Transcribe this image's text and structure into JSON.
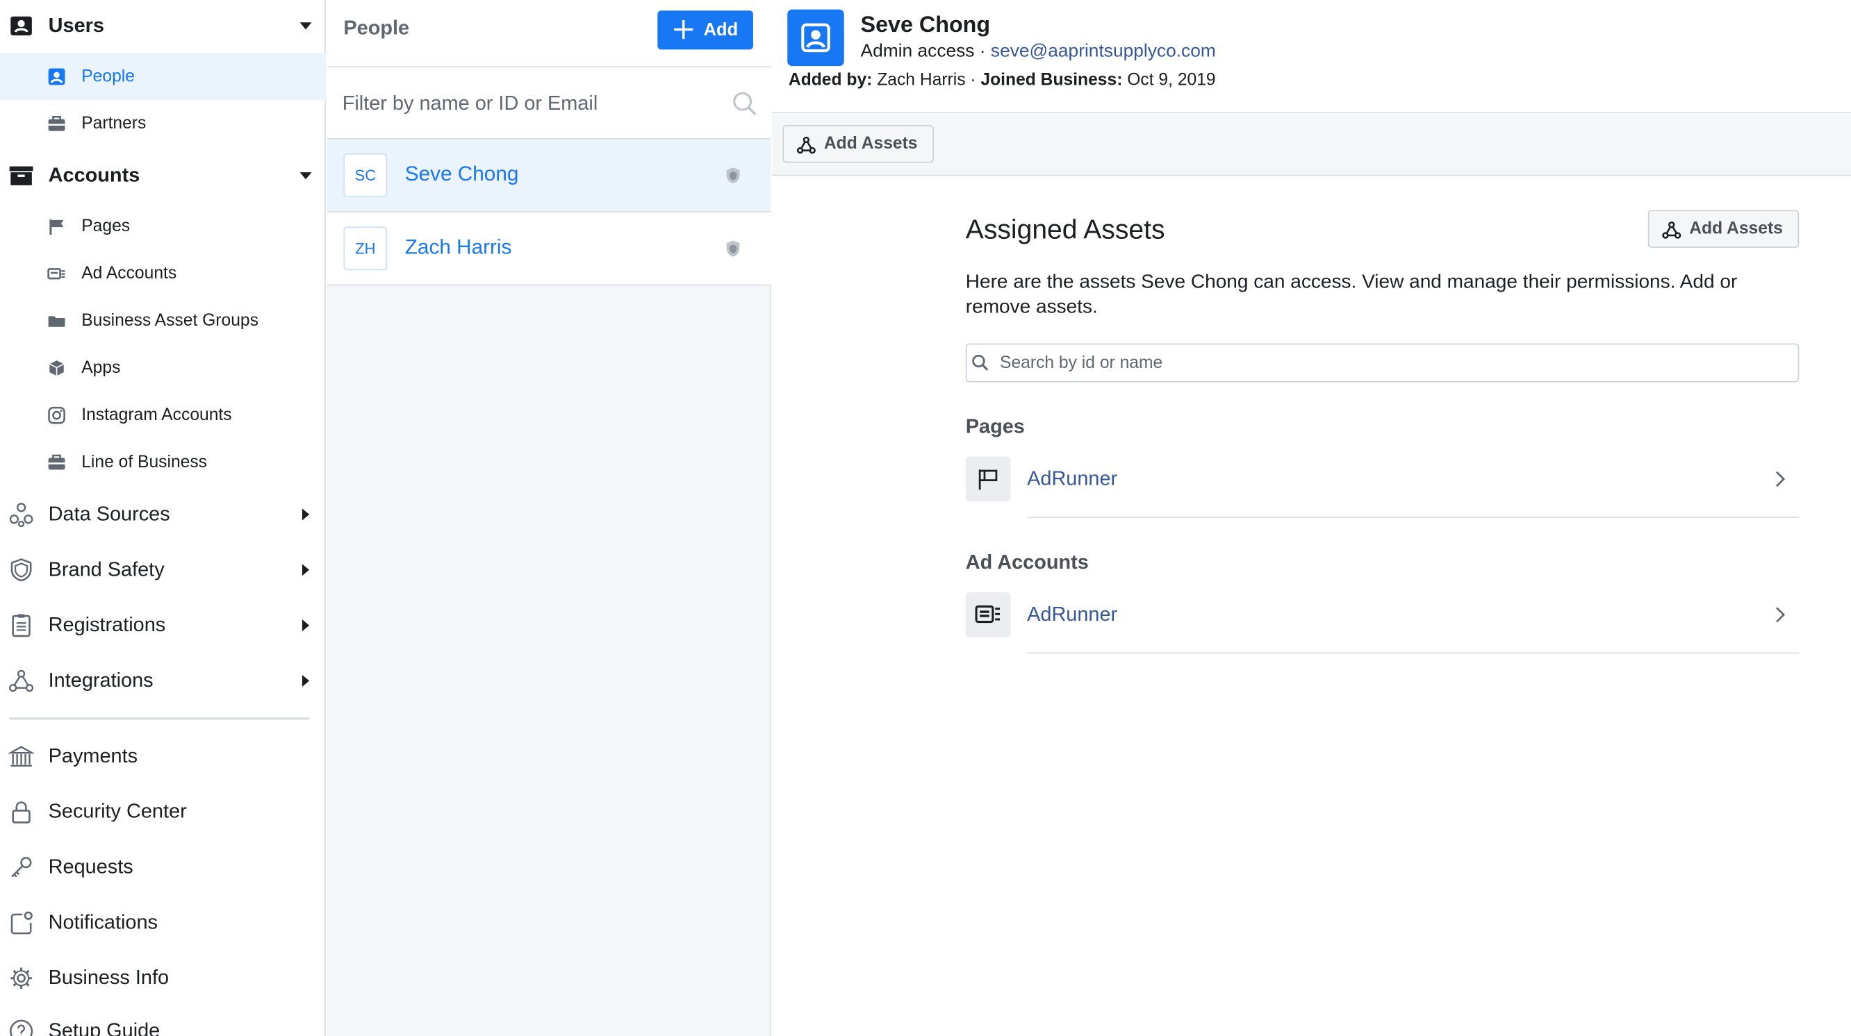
{
  "sidebar": {
    "users": {
      "label": "Users",
      "icon": "users-icon"
    },
    "users_items": [
      {
        "label": "People",
        "icon": "person-icon",
        "active": true
      },
      {
        "label": "Partners",
        "icon": "briefcase-icon"
      }
    ],
    "accounts": {
      "label": "Accounts",
      "icon": "accounts-icon"
    },
    "accounts_items": [
      {
        "label": "Pages",
        "icon": "flag-icon"
      },
      {
        "label": "Ad Accounts",
        "icon": "ad-account-icon"
      },
      {
        "label": "Business Asset Groups",
        "icon": "folder-icon"
      },
      {
        "label": "Apps",
        "icon": "cube-icon"
      },
      {
        "label": "Instagram Accounts",
        "icon": "instagram-icon"
      },
      {
        "label": "Line of Business",
        "icon": "briefcase-icon"
      }
    ],
    "sections": [
      {
        "label": "Data Sources",
        "icon": "data-sources-icon"
      },
      {
        "label": "Brand Safety",
        "icon": "shield-icon"
      },
      {
        "label": "Registrations",
        "icon": "clipboard-icon"
      },
      {
        "label": "Integrations",
        "icon": "integrations-icon"
      }
    ],
    "bottom": [
      {
        "label": "Payments",
        "icon": "bank-icon"
      },
      {
        "label": "Security Center",
        "icon": "lock-icon"
      },
      {
        "label": "Requests",
        "icon": "key-icon"
      },
      {
        "label": "Notifications",
        "icon": "notification-icon"
      },
      {
        "label": "Business Info",
        "icon": "gear-icon"
      },
      {
        "label": "Setup Guide",
        "icon": "help-icon"
      }
    ]
  },
  "people": {
    "title": "People",
    "add_label": "Add",
    "filter_placeholder": "Filter by name or ID or Email",
    "list": [
      {
        "initials": "SC",
        "name": "Seve Chong",
        "active": true
      },
      {
        "initials": "ZH",
        "name": "Zach Harris",
        "active": false
      }
    ]
  },
  "detail": {
    "name": "Seve Chong",
    "access": "Admin access",
    "separator": " · ",
    "email": "seve@aaprintsupplyco.com",
    "added_by_label": "Added by:",
    "added_by": "Zach Harris",
    "joined_label": "Joined Business:",
    "joined": "Oct 9, 2019",
    "toolbar_add": "Add Assets",
    "assigned_title": "Assigned Assets",
    "assigned_add": "Add Assets",
    "description": "Here are the assets Seve Chong can access. View and manage their permissions. Add or remove assets.",
    "search_placeholder": "Search by id or name",
    "sections": [
      {
        "title": "Pages",
        "items": [
          {
            "name": "AdRunner",
            "icon": "flag-icon"
          }
        ]
      },
      {
        "title": "Ad Accounts",
        "items": [
          {
            "name": "AdRunner",
            "icon": "ad-account-icon"
          }
        ]
      }
    ]
  },
  "colors": {
    "accent": "#1877f2",
    "active_bg": "#ebf3fd",
    "link": "#365899",
    "border": "#dadde1"
  }
}
